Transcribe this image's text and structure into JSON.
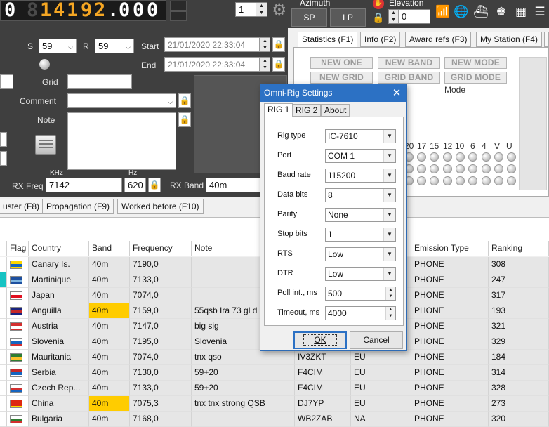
{
  "topbar": {
    "frequency_digits": [
      "0",
      "8",
      "1",
      "4",
      "1",
      "9",
      "2",
      ".",
      "0",
      "0",
      "0"
    ],
    "step_value": "1",
    "azimuth_label": "Azimuth",
    "sp_label": "SP",
    "lp_label": "LP",
    "elevation_label": "Elevation",
    "elevation_value": "0"
  },
  "left_panel": {
    "s_label": "S",
    "s_value": "59",
    "r_label": "R",
    "r_value": "59",
    "start_label": "Start",
    "start_value": "21/01/2020 22:33:04",
    "end_label": "End",
    "end_value": "21/01/2020 22:33:04",
    "grid_label": "Grid",
    "grid_value": "",
    "comment_label": "Comment",
    "comment_value": "",
    "note_label": "Note",
    "note_value": "",
    "khz_label": "KHz",
    "hz_label": "Hz",
    "rx_freq_label": "RX Freq",
    "rx_freq_value": "7142",
    "rx_hz_value": "620",
    "rx_band_label": "RX Band",
    "rx_band_value": "40m"
  },
  "right_panel": {
    "tabs": [
      "Statistics (F1)",
      "Info (F2)",
      "Award refs (F3)",
      "My Station (F4)"
    ],
    "new_buttons": [
      "NEW ONE",
      "NEW BAND",
      "NEW MODE",
      "NEW GRID",
      "GRID BAND",
      "GRID MODE"
    ],
    "mode_label": "Mode",
    "band_labels": [
      "20",
      "17",
      "15",
      "12",
      "10",
      "6",
      "4",
      "V",
      "U"
    ]
  },
  "bottom_tabs": [
    "uster (F8)",
    "Propagation (F9)",
    "Worked before (F10)"
  ],
  "grid": {
    "columns": [
      "Flag",
      "Country",
      "Band",
      "Frequency",
      "Note",
      "",
      "",
      "Emission Type",
      "Ranking"
    ],
    "rows": [
      {
        "country": "Canary Is.",
        "band": "40m",
        "freq": "7190,0",
        "note": "",
        "call": "",
        "cont": "",
        "emission": "PHONE",
        "rank": "308",
        "hl": false
      },
      {
        "country": "Martinique",
        "band": "40m",
        "freq": "7133,0",
        "note": "",
        "call": "",
        "cont": "",
        "emission": "PHONE",
        "rank": "247",
        "hl": false
      },
      {
        "country": "Japan",
        "band": "40m",
        "freq": "7074,0",
        "note": "",
        "call": "",
        "cont": "",
        "emission": "PHONE",
        "rank": "317",
        "hl": false
      },
      {
        "country": "Anguilla",
        "band": "40m",
        "freq": "7159,0",
        "note": "55qsb Ira 73 gl d",
        "call": "",
        "cont": "",
        "emission": "PHONE",
        "rank": "193",
        "hl": true
      },
      {
        "country": "Austria",
        "band": "40m",
        "freq": "7147,0",
        "note": "big sig",
        "call": "",
        "cont": "",
        "emission": "PHONE",
        "rank": "321",
        "hl": false
      },
      {
        "country": "Slovenia",
        "band": "40m",
        "freq": "7195,0",
        "note": "Slovenia",
        "call": "",
        "cont": "",
        "emission": "PHONE",
        "rank": "329",
        "hl": false
      },
      {
        "country": "Mauritania",
        "band": "40m",
        "freq": "7074,0",
        "note": "tnx qso",
        "call": "IV3ZKT",
        "cont": "EU",
        "emission": "PHONE",
        "rank": "184",
        "hl": false
      },
      {
        "country": "Serbia",
        "band": "40m",
        "freq": "7130,0",
        "note": "59+20",
        "call": "F4CIM",
        "cont": "EU",
        "emission": "PHONE",
        "rank": "314",
        "hl": false
      },
      {
        "country": "Czech Rep...",
        "band": "40m",
        "freq": "7133,0",
        "note": "59+20",
        "call": "F4CIM",
        "cont": "EU",
        "emission": "PHONE",
        "rank": "328",
        "hl": false
      },
      {
        "country": "China",
        "band": "40m",
        "freq": "7075,3",
        "note": "tnx tnx strong QSB",
        "call": "DJ7YP",
        "cont": "EU",
        "emission": "PHONE",
        "rank": "273",
        "hl": true
      },
      {
        "country": "Bulgaria",
        "band": "40m",
        "freq": "7168,0",
        "note": "",
        "call": "WB2ZAB",
        "cont": "NA",
        "emission": "PHONE",
        "rank": "320",
        "hl": false
      }
    ]
  },
  "dialog": {
    "title": "Omni-Rig Settings",
    "tabs": [
      "RIG 1",
      "RIG 2",
      "About"
    ],
    "fields": [
      {
        "label": "Rig type",
        "value": "IC-7610",
        "kind": "combo"
      },
      {
        "label": "Port",
        "value": "COM 1",
        "kind": "combo"
      },
      {
        "label": "Baud rate",
        "value": "115200",
        "kind": "combo"
      },
      {
        "label": "Data bits",
        "value": "8",
        "kind": "combo"
      },
      {
        "label": "Parity",
        "value": "None",
        "kind": "combo"
      },
      {
        "label": "Stop bits",
        "value": "1",
        "kind": "combo"
      },
      {
        "label": "RTS",
        "value": "Low",
        "kind": "combo"
      },
      {
        "label": "DTR",
        "value": "Low",
        "kind": "combo"
      },
      {
        "label": "Poll int., ms",
        "value": "500",
        "kind": "spin"
      },
      {
        "label": "Timeout, ms",
        "value": "4000",
        "kind": "spin"
      }
    ],
    "ok_label": "OK",
    "cancel_label": "Cancel"
  },
  "colors": {
    "highlight_band": "#ffcc00",
    "dialog_title": "#2c71c4",
    "dark_panel": "#3f3f3f",
    "digit_lit": "#f5a623"
  }
}
